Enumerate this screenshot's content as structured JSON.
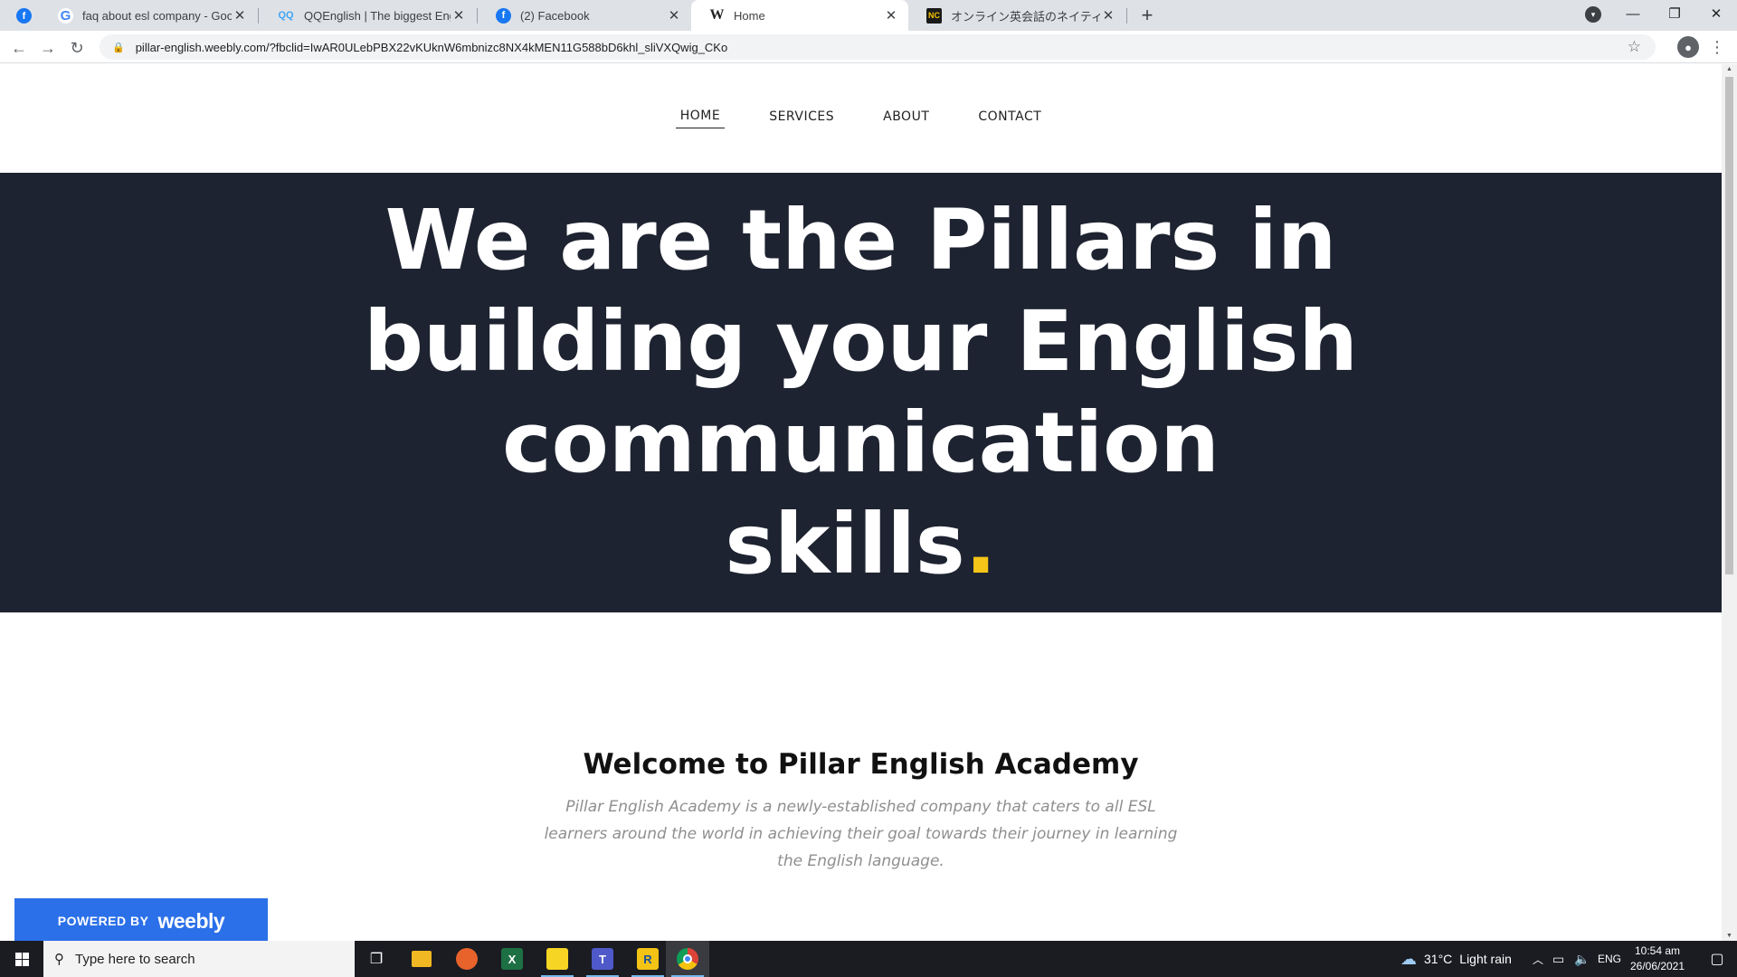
{
  "browser": {
    "tabs": [
      {
        "label": "faq about esl company - Google",
        "favicon": "google-icon"
      },
      {
        "label": "QQEnglish | The biggest English",
        "favicon": "qqenglish-icon"
      },
      {
        "label": "(2) Facebook",
        "favicon": "facebook-icon"
      },
      {
        "label": "Home",
        "favicon": "weebly-icon",
        "active": true
      },
      {
        "label": "オンライン英会話のネイティブキャンプ",
        "favicon": "nativecamp-icon"
      }
    ],
    "url": "pillar-english.weebly.com/?fbclid=IwAR0ULebPBX22vKUknW6mbnizc8NX4kMEN11G588bD6khl_sliVXQwig_CKo"
  },
  "site": {
    "nav": [
      {
        "label": "HOME",
        "active": true
      },
      {
        "label": "SERVICES"
      },
      {
        "label": "ABOUT"
      },
      {
        "label": "CONTACT"
      }
    ],
    "hero": {
      "title": "We are the Pillars in building your English communication skills",
      "dot": ".",
      "dot_color": "#f5c518",
      "background": "#1e2331"
    },
    "welcome": {
      "title": "Welcome to Pillar English Academy",
      "text": "Pillar English Academy is a newly-established company that caters to all ESL learners around the world in achieving their goal towards their journey in learning the English language."
    },
    "badge": {
      "powered_by": "POWERED BY",
      "brand": "weebly",
      "color": "#2b70e8"
    }
  },
  "taskbar": {
    "search_placeholder": "Type here to search",
    "weather": {
      "temp": "31°C",
      "condition": "Light rain"
    },
    "language": "ENG",
    "time": "10:54 am",
    "date": "26/06/2021",
    "apps": [
      "task-view-icon",
      "file-explorer-icon",
      "firefox-icon",
      "excel-icon",
      "sticky-notes-icon",
      "teams-icon",
      "rakuten-icon",
      "chrome-icon"
    ]
  }
}
